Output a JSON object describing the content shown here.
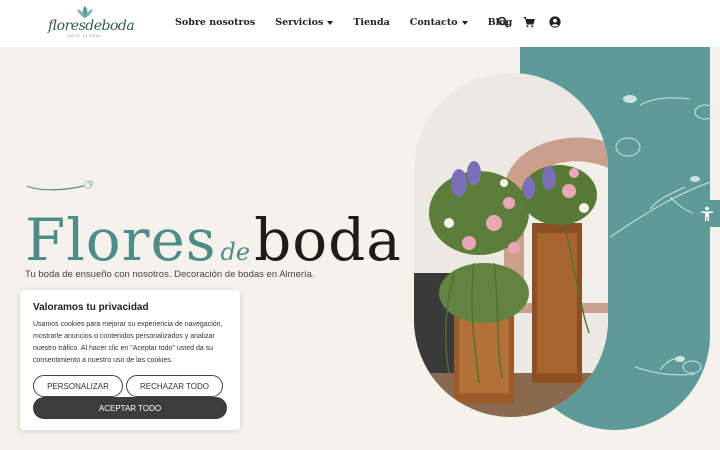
{
  "brand": {
    "logo_text": "floresdeboda",
    "logo_tagline": "ARTE FLORAL",
    "accent_color": "#5e9b98"
  },
  "nav": {
    "items": [
      {
        "label": "Sobre nosotros",
        "has_dropdown": false
      },
      {
        "label": "Servicios",
        "has_dropdown": true
      },
      {
        "label": "Tienda",
        "has_dropdown": false
      },
      {
        "label": "Contacto",
        "has_dropdown": true
      },
      {
        "label": "Blog",
        "has_dropdown": false
      }
    ],
    "icons": [
      "search-icon",
      "cart-icon",
      "user-account-icon"
    ]
  },
  "hero": {
    "title_part1": "Flores",
    "title_part2": "de",
    "title_part3": "boda",
    "subtitle": "Tu boda de ensueño con nosotros. Decoración de bodas en Almería."
  },
  "cookie_banner": {
    "title": "Valoramos tu privacidad",
    "text": "Usamos cookies para mejorar su experiencia de navegación, mostrarle anuncios o contenidos personalizados y analizar nuestro tráfico. Al hacer clic en \"Aceptar todo\" usted da su consentimiento a nuestro uso de las cookies.",
    "personalize_label": "PERSONALIZAR",
    "reject_label": "RECHAZAR TODO",
    "accept_label": "ACEPTAR TODO"
  },
  "accessibility_icon": "accessibility-icon"
}
